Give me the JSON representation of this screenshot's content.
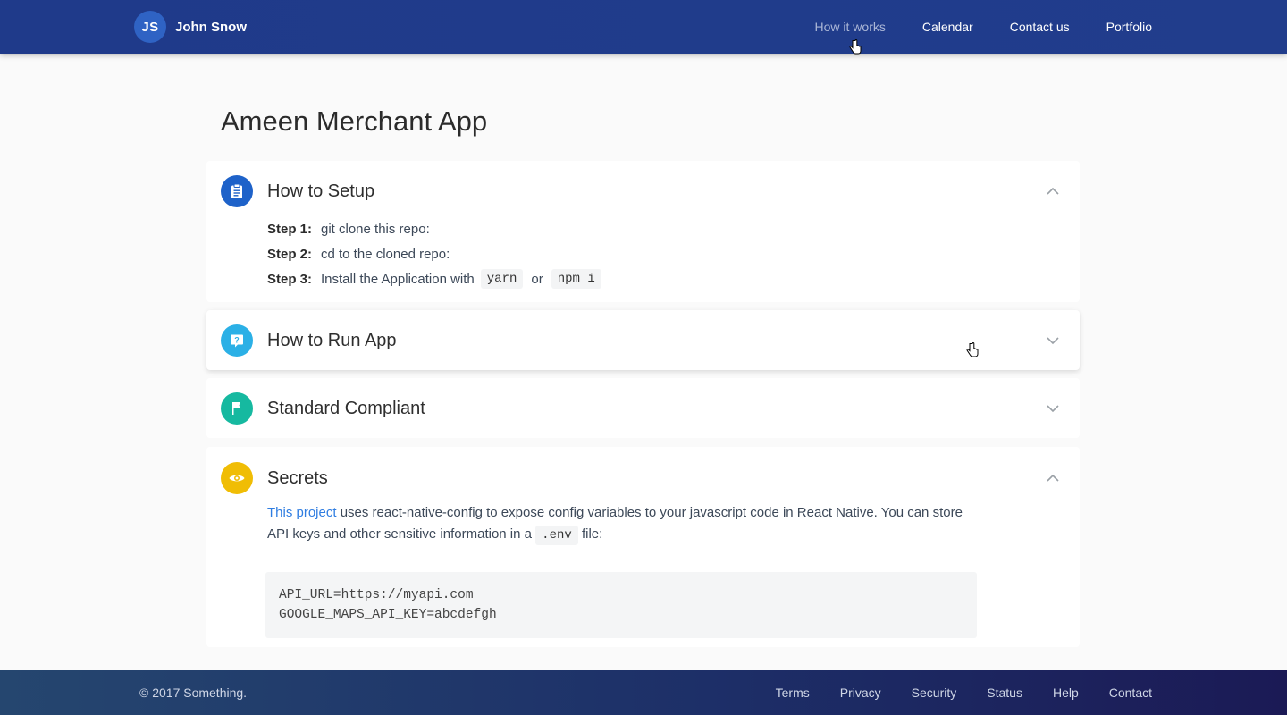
{
  "header": {
    "avatar_initials": "JS",
    "brand_name": "John Snow",
    "nav": [
      "How it works",
      "Calendar",
      "Contact us",
      "Portfolio"
    ]
  },
  "main": {
    "title": "Ameen Merchant App",
    "sections": [
      {
        "title": "How to Setup",
        "icon": "clipboard-icon",
        "color": "#1e62c9",
        "expanded": true,
        "steps": [
          {
            "label": "Step 1:",
            "text": "git clone this repo:"
          },
          {
            "label": "Step 2:",
            "text": "cd to the cloned repo:"
          },
          {
            "label": "Step 3:",
            "text": "Install the Application with",
            "code1": "yarn",
            "or": "or",
            "code2": "npm i"
          }
        ]
      },
      {
        "title": "How to Run App",
        "icon": "question-icon",
        "color": "#2bb0e6",
        "expanded": false
      },
      {
        "title": "Standard Compliant",
        "icon": "flag-icon",
        "color": "#16b9a0",
        "expanded": false
      },
      {
        "title": "Secrets",
        "icon": "eye-icon",
        "color": "#f0bd05",
        "expanded": true,
        "link_text": "This project",
        "text_before_code": "uses react-native-config to expose config variables to your javascript code in React Native. You can store API keys and other sensitive information in a",
        "inline_code": ".env",
        "text_after_code": "file:",
        "code_lines": [
          "API_URL=https://myapi.com",
          "GOOGLE_MAPS_API_KEY=abcdefgh"
        ]
      }
    ]
  },
  "footer": {
    "copyright": "© 2017 Something.",
    "links": [
      "Terms",
      "Privacy",
      "Security",
      "Status",
      "Help",
      "Contact"
    ]
  }
}
